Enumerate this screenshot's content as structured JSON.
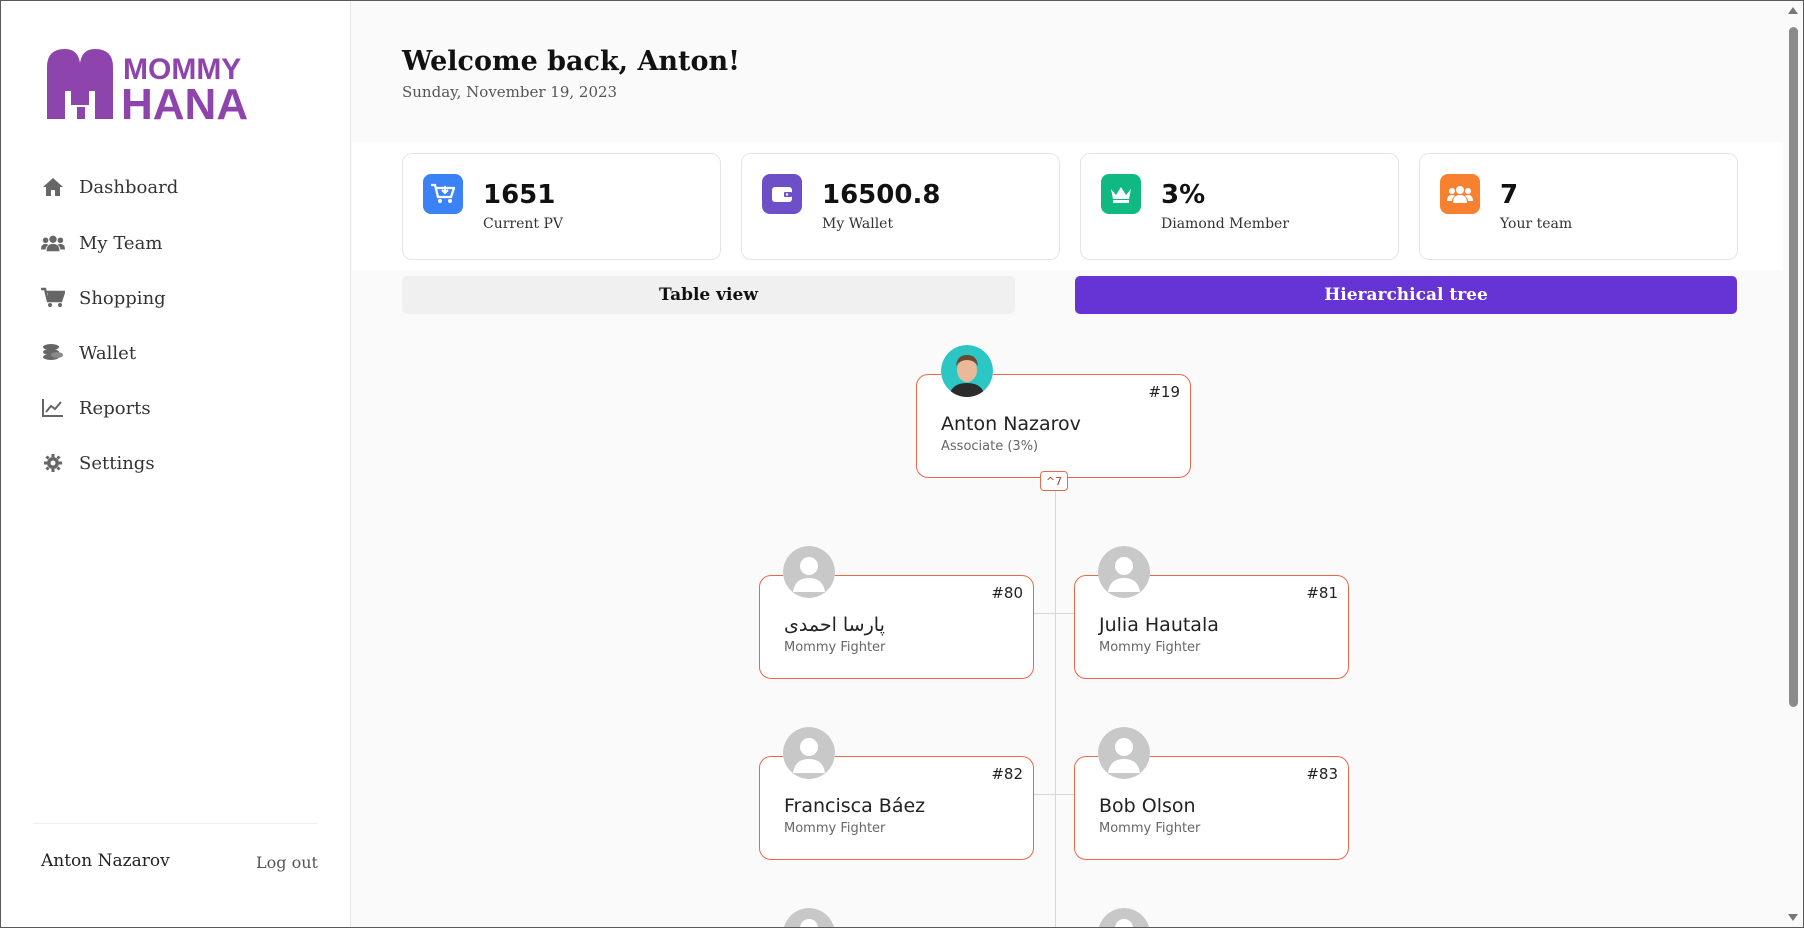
{
  "brand": {
    "name_line1": "MOMMY",
    "name_line2": "HANA",
    "color": "#8e44ad"
  },
  "sidebar": {
    "items": [
      {
        "label": "Dashboard",
        "icon": "home-icon"
      },
      {
        "label": "My Team",
        "icon": "users-icon"
      },
      {
        "label": "Shopping",
        "icon": "cart-icon"
      },
      {
        "label": "Wallet",
        "icon": "coins-icon"
      },
      {
        "label": "Reports",
        "icon": "chart-line-icon"
      },
      {
        "label": "Settings",
        "icon": "gear-icon"
      }
    ],
    "user_name": "Anton Nazarov",
    "logout_label": "Log out"
  },
  "header": {
    "welcome": "Welcome back, Anton!",
    "date": "Sunday, November 19, 2023"
  },
  "stats": [
    {
      "value": "1651",
      "label": "Current PV",
      "icon": "cart-download-icon",
      "color": "#3b82f6"
    },
    {
      "value": "16500.8",
      "label": "My Wallet",
      "icon": "wallet-icon",
      "color": "#6d4fc7"
    },
    {
      "value": "3%",
      "label": "Diamond Member",
      "icon": "crown-icon",
      "color": "#10b981"
    },
    {
      "value": "7",
      "label": "Your team",
      "icon": "users-icon",
      "color": "#f7812e"
    }
  ],
  "view_toggle": {
    "table_label": "Table view",
    "tree_label": "Hierarchical tree",
    "active": "Hierarchical tree",
    "active_color": "#6633d4"
  },
  "tree": {
    "root": {
      "id": "#19",
      "name": "Anton Nazarov",
      "role": "Associate (3%)",
      "children_count": "7"
    },
    "children": [
      {
        "id": "#80",
        "name": "پارسا احمدی",
        "role": "Mommy Fighter"
      },
      {
        "id": "#81",
        "name": "Julia Hautala",
        "role": "Mommy Fighter"
      },
      {
        "id": "#82",
        "name": "Francisca Báez",
        "role": "Mommy Fighter"
      },
      {
        "id": "#83",
        "name": "Bob Olson",
        "role": "Mommy Fighter"
      }
    ],
    "node_border_color": "#e8694a"
  }
}
